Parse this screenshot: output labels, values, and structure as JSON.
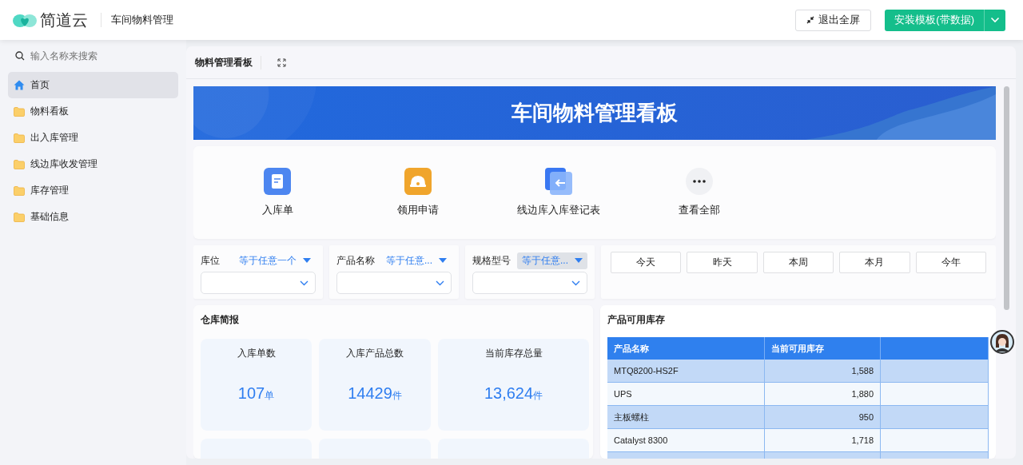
{
  "app": {
    "brand": "简道云",
    "title": "车间物料管理"
  },
  "header_buttons": {
    "exit_fullscreen": "退出全屏",
    "install": "安装模板(带数据)"
  },
  "sidebar": {
    "search": {
      "placeholder": "输入名称来搜索"
    },
    "items": [
      {
        "label": "首页",
        "kind": "home",
        "selected": true
      },
      {
        "label": "物料看板",
        "kind": "folder",
        "selected": false
      },
      {
        "label": "出入库管理",
        "kind": "folder",
        "selected": false
      },
      {
        "label": "线边库收发管理",
        "kind": "folder",
        "selected": false
      },
      {
        "label": "库存管理",
        "kind": "folder",
        "selected": false
      },
      {
        "label": "基础信息",
        "kind": "folder",
        "selected": false
      }
    ]
  },
  "page": {
    "title": "物料管理看板",
    "banner": "车间物料管理看板",
    "quick_links": [
      {
        "label": "入库单",
        "kind": "form"
      },
      {
        "label": "领用申请",
        "kind": "helmet"
      },
      {
        "label": "线边库入库登记表",
        "kind": "import"
      },
      {
        "label": "查看全部",
        "kind": "more"
      }
    ],
    "filters": [
      {
        "label": "库位",
        "operator": "等于任意一个",
        "active": false
      },
      {
        "label": "产品名称",
        "operator": "等于任意...",
        "active": false
      },
      {
        "label": "规格型号",
        "operator": "等于任意...",
        "active": true
      }
    ],
    "date_buttons": [
      "今天",
      "昨天",
      "本周",
      "本月",
      "今年"
    ],
    "summary": {
      "title": "仓库简报",
      "stats": [
        {
          "label": "入库单数",
          "value": "107",
          "unit": "单"
        },
        {
          "label": "入库产品总数",
          "value": "14429",
          "unit": "件"
        },
        {
          "label": "当前库存总量",
          "value": "13,624",
          "unit": "件"
        }
      ]
    },
    "stock": {
      "title": "产品可用库存",
      "columns": [
        "产品名称",
        "当前可用库存"
      ],
      "rows": [
        [
          "MTQ8200-HS2F",
          "1,588"
        ],
        [
          "UPS",
          "1,880"
        ],
        [
          "主板螺柱",
          "950"
        ],
        [
          "Catalyst 8300",
          "1,718"
        ]
      ]
    }
  }
}
